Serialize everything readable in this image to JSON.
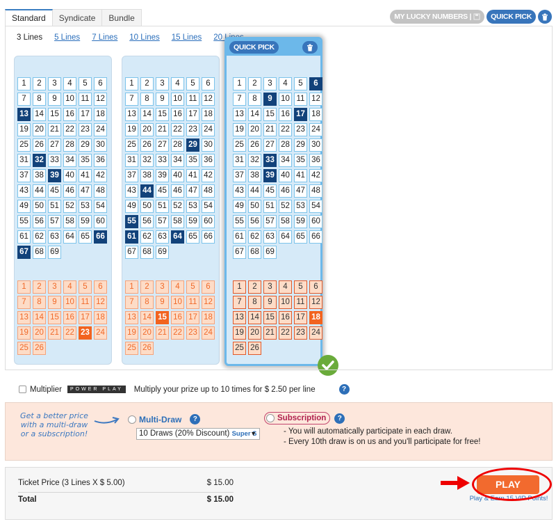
{
  "tabs": [
    {
      "label": "Standard",
      "active": true
    },
    {
      "label": "Syndicate",
      "active": false
    },
    {
      "label": "Bundle",
      "active": false
    }
  ],
  "top_actions": {
    "my_lucky_numbers": "MY LUCKY NUMBERS |",
    "quick_pick": "QUICK PICK"
  },
  "lines_options": [
    {
      "label": "3 Lines",
      "selected": true
    },
    {
      "label": "5 Lines",
      "selected": false
    },
    {
      "label": "7 Lines",
      "selected": false
    },
    {
      "label": "10 Lines",
      "selected": false
    },
    {
      "label": "15 Lines",
      "selected": false
    },
    {
      "label": "20 Lines",
      "selected": false
    }
  ],
  "lines": [
    {
      "main_selected": [
        13,
        32,
        39,
        66,
        67
      ],
      "pb_selected": [
        23
      ],
      "quick_pick": false
    },
    {
      "main_selected": [
        29,
        44,
        55,
        61,
        64
      ],
      "pb_selected": [
        15
      ],
      "quick_pick": false
    },
    {
      "main_selected": [
        6,
        9,
        17,
        33,
        39
      ],
      "pb_selected": [
        18
      ],
      "quick_pick": true,
      "complete": true
    }
  ],
  "main_max": 69,
  "pb_max": 26,
  "card_quick_pick_label": "QUICK PICK",
  "multiplier": {
    "label": "Multiplier",
    "logo": "POWER PLAY",
    "description": "Multiply your prize up to 10 times for $ 2.50 per line",
    "checked": false
  },
  "offers": {
    "promo": "Get a better price with a multi-draw or a subscription!",
    "multi_draw_label": "Multi-Draw",
    "multi_draw_select": "10 Draws (20% Discount)",
    "multi_draw_select_extra": "Super S",
    "subscription_label": "Subscription",
    "subscription_notes": [
      "- You will automatically participate in each draw.",
      "- Every 10th draw is on us and you'll participate for free!"
    ]
  },
  "summary": {
    "ticket_label": "Ticket Price (3 Lines X $ 5.00)",
    "ticket_value": "$ 15.00",
    "total_label": "Total",
    "total_value": "$ 15.00"
  },
  "play": {
    "label": "PLAY",
    "note": "Play & Earn 15 VIP Points!"
  },
  "colors": {
    "accent_blue": "#3875bb",
    "selected_number": "#12427a",
    "powerball_selected": "#f2631f",
    "play_button": "#f26a2e"
  }
}
